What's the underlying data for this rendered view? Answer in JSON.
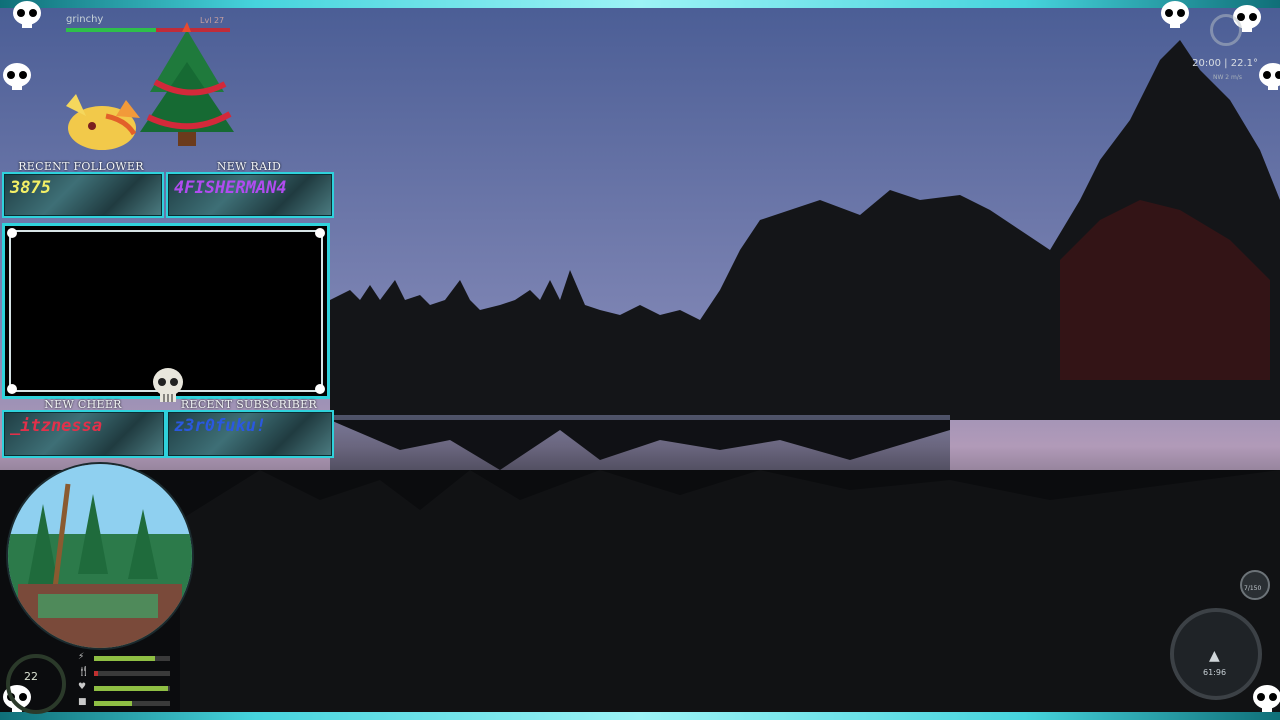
{
  "game_hud": {
    "player_name": "grinchy",
    "player_level": "Lvl 27",
    "health_fraction": 0.55,
    "time": "20:00",
    "temperature": "22.1°",
    "wind": "NW 2 m/s",
    "compass_value": "61:96",
    "fish_count": "7/150",
    "gauge_value": "22"
  },
  "stream_overlay": {
    "recent_follower_label": "RECENT FOLLOWER",
    "recent_follower_value": "3875",
    "new_raid_label": "NEW RAID",
    "new_raid_value": "4FISHERMAN4",
    "new_cheer_label": "NEW CHEER",
    "new_cheer_value": "_itznessa",
    "recent_subscriber_label": "RECENT SUBSCRIBER",
    "recent_subscriber_value": "z3r0fuku!"
  },
  "stats": [
    {
      "icon": "⚡",
      "fraction": 0.8,
      "color": "#8fbf44"
    },
    {
      "icon": "🍴",
      "fraction": 0.05,
      "color": "#c03030"
    },
    {
      "icon": "♥",
      "fraction": 0.98,
      "color": "#8fbf44"
    },
    {
      "icon": "■",
      "fraction": 0.5,
      "color": "#8fbf44"
    }
  ],
  "colors": {
    "accent": "#2fd2dc",
    "follower_text": "#f4f066",
    "raid_text": "#b04cf0",
    "cheer_text": "#e2304a",
    "subscriber_text": "#2a58e0"
  }
}
